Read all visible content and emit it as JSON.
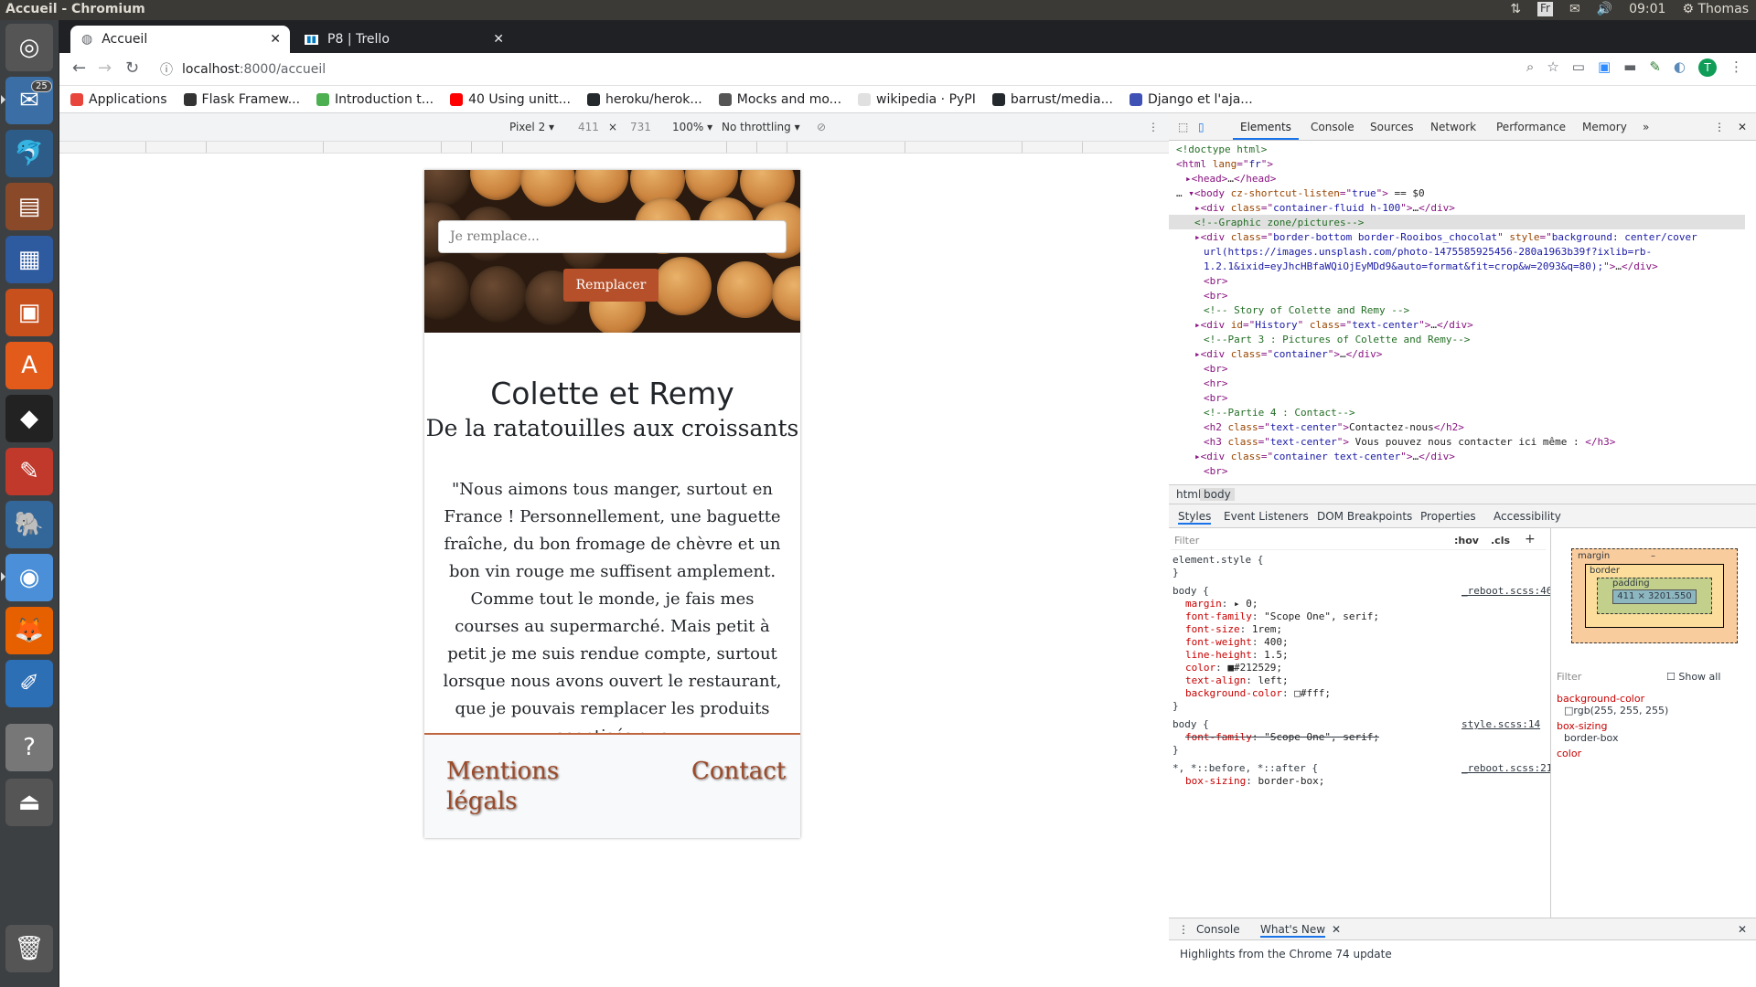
{
  "system": {
    "window_title": "Accueil - Chromium",
    "lang": "Fr",
    "time": "09:01",
    "user": "Thomas",
    "mail_badge": "25"
  },
  "tabs": [
    {
      "label": "Accueil"
    },
    {
      "label": "P8 | Trello"
    }
  ],
  "toolbar": {
    "url_host": "localhost",
    "url_path": ":8000/accueil"
  },
  "bookmarks": [
    {
      "label": "Applications",
      "color": "#e8453c"
    },
    {
      "label": "Flask Framew...",
      "color": "#333333"
    },
    {
      "label": "Introduction t...",
      "color": "#4caf50"
    },
    {
      "label": "40 Using unitt...",
      "color": "#ff0000"
    },
    {
      "label": "heroku/herok...",
      "color": "#24292e"
    },
    {
      "label": "Mocks and mo...",
      "color": "#555555"
    },
    {
      "label": "wikipedia · PyPI",
      "color": "#e0e0e0"
    },
    {
      "label": "barrust/media...",
      "color": "#24292e"
    },
    {
      "label": "Django et l'aja...",
      "color": "#3f51b5"
    }
  ],
  "device": {
    "name": "Pixel 2",
    "width": "411",
    "height": "731",
    "zoom": "100%",
    "throttle": "No throttling",
    "sep": "×"
  },
  "page": {
    "search_placeholder": "Je remplace...",
    "replace_button": "Remplacer",
    "title": "Colette et Remy",
    "subtitle": "De la ratatouilles aux croissants",
    "story": "\"Nous aimons tous manger, surtout en France ! Personnellement, une baguette fraîche, du bon fromage de chèvre et un bon vin rouge me suffisent amplement. Comme tout le monde, je fais mes courses au supermarché. Mais petit à petit je me suis rendue compte, surtout lorsque nous avons ouvert le restaurant, que je pouvais remplacer les produits aseptisés que",
    "footer_legal": "Mentions légals",
    "footer_contact": "Contact"
  },
  "devtools": {
    "tabs": [
      "Elements",
      "Console",
      "Sources",
      "Network",
      "Performance",
      "Memory"
    ],
    "dom_lines": [
      {
        "indent": 0,
        "parts": [
          [
            "cm",
            "<!doctype html>"
          ]
        ]
      },
      {
        "indent": 0,
        "parts": [
          [
            "tag",
            "<html "
          ],
          [
            "an",
            "lang"
          ],
          [
            "tag",
            "=\""
          ],
          [
            "av",
            "fr"
          ],
          [
            "tag",
            "\">"
          ]
        ]
      },
      {
        "indent": 1,
        "parts": [
          [
            "tag",
            "▸<head>"
          ],
          [
            "tx",
            "…"
          ],
          [
            "tag",
            "</head>"
          ]
        ]
      },
      {
        "indent": 0,
        "parts": [
          [
            "tx",
            "… "
          ],
          [
            "tag",
            "▾<body "
          ],
          [
            "an",
            "cz-shortcut-listen"
          ],
          [
            "tag",
            "=\""
          ],
          [
            "av",
            "true"
          ],
          [
            "tag",
            "\">"
          ],
          [
            "tx",
            " == $0"
          ]
        ]
      },
      {
        "indent": 2,
        "parts": [
          [
            "tag",
            "▸<div "
          ],
          [
            "an",
            "class"
          ],
          [
            "tag",
            "=\""
          ],
          [
            "av",
            "container-fluid h-100"
          ],
          [
            "tag",
            "\">"
          ],
          [
            "tx",
            "…"
          ],
          [
            "tag",
            "</div>"
          ]
        ]
      },
      {
        "indent": 2,
        "parts": [
          [
            "cm",
            "<!--Graphic zone/pictures-->"
          ]
        ]
      },
      {
        "indent": 2,
        "parts": [
          [
            "tag",
            "▸<div "
          ],
          [
            "an",
            "class"
          ],
          [
            "tag",
            "=\""
          ],
          [
            "av",
            "border-bottom border-Rooibos_chocolat"
          ],
          [
            "tag",
            "\" "
          ],
          [
            "an",
            "style"
          ],
          [
            "tag",
            "=\""
          ],
          [
            "av",
            "background: center/cover"
          ]
        ]
      },
      {
        "indent": 3,
        "parts": [
          [
            "av",
            "url(https://images.unsplash.com/photo-1475585925456-280a1963b39f?ixlib=rb-"
          ]
        ]
      },
      {
        "indent": 3,
        "parts": [
          [
            "av",
            "1.2.1&ixid=eyJhcHBfaWQiOjEyMDd9&auto=format&fit=crop&w=2093&q=80);"
          ],
          [
            "tag",
            "\">"
          ],
          [
            "tx",
            "…"
          ],
          [
            "tag",
            "</div>"
          ]
        ]
      },
      {
        "indent": 3,
        "parts": [
          [
            "tag",
            "<br>"
          ]
        ]
      },
      {
        "indent": 3,
        "parts": [
          [
            "tag",
            "<br>"
          ]
        ]
      },
      {
        "indent": 3,
        "parts": [
          [
            "cm",
            "<!-- Story of Colette and Remy -->"
          ]
        ]
      },
      {
        "indent": 2,
        "parts": [
          [
            "tag",
            "▸<div "
          ],
          [
            "an",
            "id"
          ],
          [
            "tag",
            "=\""
          ],
          [
            "av",
            "History"
          ],
          [
            "tag",
            "\" "
          ],
          [
            "an",
            "class"
          ],
          [
            "tag",
            "=\""
          ],
          [
            "av",
            "text-center"
          ],
          [
            "tag",
            "\">"
          ],
          [
            "tx",
            "…"
          ],
          [
            "tag",
            "</div>"
          ]
        ]
      },
      {
        "indent": 3,
        "parts": [
          [
            "cm",
            "<!--Part 3 : Pictures of Colette and Remy-->"
          ]
        ]
      },
      {
        "indent": 2,
        "parts": [
          [
            "tag",
            "▸<div "
          ],
          [
            "an",
            "class"
          ],
          [
            "tag",
            "=\""
          ],
          [
            "av",
            "container"
          ],
          [
            "tag",
            "\">"
          ],
          [
            "tx",
            "…"
          ],
          [
            "tag",
            "</div>"
          ]
        ]
      },
      {
        "indent": 3,
        "parts": [
          [
            "tag",
            "<br>"
          ]
        ]
      },
      {
        "indent": 3,
        "parts": [
          [
            "tag",
            "<hr>"
          ]
        ]
      },
      {
        "indent": 3,
        "parts": [
          [
            "tag",
            "<br>"
          ]
        ]
      },
      {
        "indent": 3,
        "parts": [
          [
            "cm",
            "<!--Partie 4 : Contact-->"
          ]
        ]
      },
      {
        "indent": 3,
        "parts": [
          [
            "tag",
            "<h2 "
          ],
          [
            "an",
            "class"
          ],
          [
            "tag",
            "=\""
          ],
          [
            "av",
            "text-center"
          ],
          [
            "tag",
            "\">"
          ],
          [
            "tx",
            "Contactez-nous"
          ],
          [
            "tag",
            "</h2>"
          ]
        ]
      },
      {
        "indent": 3,
        "parts": [
          [
            "tag",
            "<h3 "
          ],
          [
            "an",
            "class"
          ],
          [
            "tag",
            "=\""
          ],
          [
            "av",
            "text-center"
          ],
          [
            "tag",
            "\">"
          ],
          [
            "tx",
            " Vous pouvez nous contacter ici même : "
          ],
          [
            "tag",
            "</h3>"
          ]
        ]
      },
      {
        "indent": 2,
        "parts": [
          [
            "tag",
            "▸<div "
          ],
          [
            "an",
            "class"
          ],
          [
            "tag",
            "=\""
          ],
          [
            "av",
            "container text-center"
          ],
          [
            "tag",
            "\">"
          ],
          [
            "tx",
            "…"
          ],
          [
            "tag",
            "</div>"
          ]
        ]
      },
      {
        "indent": 3,
        "parts": [
          [
            "tag",
            "<br>"
          ]
        ]
      }
    ],
    "crumbs": [
      "html",
      "body"
    ],
    "sub_tabs": [
      "Styles",
      "Event Listeners",
      "DOM Breakpoints",
      "Properties",
      "Accessibility"
    ],
    "filter_placeholder": "Filter",
    "hov": ":hov",
    "cls": ".cls",
    "styles": [
      {
        "kind": "sel",
        "text": "element.style {"
      },
      {
        "kind": "close",
        "text": "}"
      },
      {
        "kind": "selsrc",
        "text": "body {",
        "src": "_reboot.scss:46"
      },
      {
        "kind": "prop",
        "name": "margin",
        "value": "▸ 0;"
      },
      {
        "kind": "prop",
        "name": "font-family",
        "value": "\"Scope One\", serif;"
      },
      {
        "kind": "prop",
        "name": "font-size",
        "value": "1rem;"
      },
      {
        "kind": "prop",
        "name": "font-weight",
        "value": "400;"
      },
      {
        "kind": "prop",
        "name": "line-height",
        "value": "1.5;"
      },
      {
        "kind": "prop",
        "name": "color",
        "value": "■#212529;"
      },
      {
        "kind": "prop",
        "name": "text-align",
        "value": "left;"
      },
      {
        "kind": "prop",
        "name": "background-color",
        "value": "□#fff;"
      },
      {
        "kind": "close",
        "text": "}"
      },
      {
        "kind": "selsrc",
        "text": "body {",
        "src": "style.scss:14"
      },
      {
        "kind": "strike",
        "name": "font-family",
        "value": "\"Scope One\", serif;"
      },
      {
        "kind": "close",
        "text": "}"
      },
      {
        "kind": "selsrc",
        "text": "*, *::before, *::after {",
        "src": "_reboot.scss:21"
      },
      {
        "kind": "prop",
        "name": "box-sizing",
        "value": "border-box;"
      }
    ],
    "boxmodel": {
      "margin": "margin",
      "border": "border",
      "padding": "padding",
      "dash": "–",
      "content": "411 × 3201.550"
    },
    "computed_filter": "Filter",
    "show_all": "Show all",
    "computed": [
      {
        "name": "background-color",
        "value": "□rgb(255, 255, 255)"
      },
      {
        "name": "box-sizing",
        "value": "border-box"
      },
      {
        "name": "color",
        "value": ""
      }
    ],
    "drawer_tabs": [
      "Console",
      "What's New"
    ],
    "drawer_heading": "Highlights from the Chrome 74 update"
  }
}
